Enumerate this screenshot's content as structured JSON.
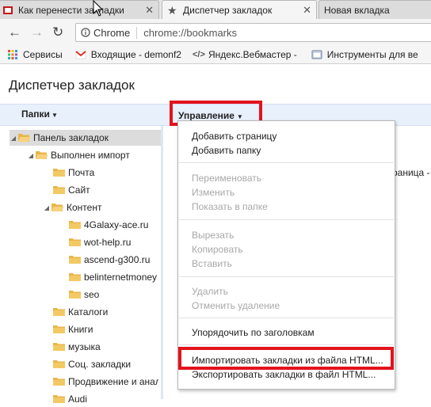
{
  "tabs": [
    {
      "title": "Как перенести закладки",
      "active": false
    },
    {
      "title": "Диспетчер закладок",
      "active": true
    },
    {
      "title": "Новая вкладка",
      "active": false
    }
  ],
  "toolbar": {
    "back_icon": "back-arrow-icon",
    "forward_icon": "forward-arrow-icon",
    "reload_icon": "reload-icon",
    "omnibox_label": "Chrome",
    "url": "chrome://bookmarks"
  },
  "bookmarks_bar": [
    {
      "label": "Сервисы",
      "icon": "apps-grid-icon"
    },
    {
      "label": "Входящие - demonf2",
      "icon": "gmail-icon"
    },
    {
      "label": "Яндекс.Вебмастер -",
      "icon": "webmaster-icon"
    },
    {
      "label": "Инструменты для ве",
      "icon": "tools-icon"
    }
  ],
  "page": {
    "title": "Диспетчер закладок",
    "folders_button": "Папки",
    "manage_button": "Управление",
    "right_partial_text": "раница - К"
  },
  "tree": [
    {
      "label": "Панель закладок",
      "open": true
    },
    {
      "label": "Выполнен импорт",
      "open": true
    },
    {
      "label": "Почта"
    },
    {
      "label": "Сайт"
    },
    {
      "label": "Контент",
      "open": true
    },
    {
      "label": "4Galaxy-ace.ru"
    },
    {
      "label": "wot-help.ru"
    },
    {
      "label": "ascend-g300.ru"
    },
    {
      "label": "belinternetmoney"
    },
    {
      "label": "seo"
    },
    {
      "label": "Каталоги"
    },
    {
      "label": "Книги"
    },
    {
      "label": "музыка"
    },
    {
      "label": "Соц. закладки"
    },
    {
      "label": "Продвижение и анали"
    },
    {
      "label": "Audi"
    }
  ],
  "menu": {
    "items": [
      {
        "label": "Добавить страницу",
        "enabled": true
      },
      {
        "label": "Добавить папку",
        "enabled": true
      },
      {
        "label": "Переименовать",
        "enabled": false
      },
      {
        "label": "Изменить",
        "enabled": false
      },
      {
        "label": "Показать в папке",
        "enabled": false
      },
      {
        "label": "Вырезать",
        "enabled": false
      },
      {
        "label": "Копировать",
        "enabled": false
      },
      {
        "label": "Вставить",
        "enabled": false
      },
      {
        "label": "Удалить",
        "enabled": false
      },
      {
        "label": "Отменить удаление",
        "enabled": false
      },
      {
        "label": "Упорядочить по заголовкам",
        "enabled": true
      },
      {
        "label": "Импортировать закладки из файла HTML...",
        "enabled": true
      },
      {
        "label": "Экспортировать закладки в файл HTML...",
        "enabled": true
      }
    ]
  },
  "colors": {
    "highlight": "#e3131c",
    "header_bg": "#e8f0fb"
  }
}
